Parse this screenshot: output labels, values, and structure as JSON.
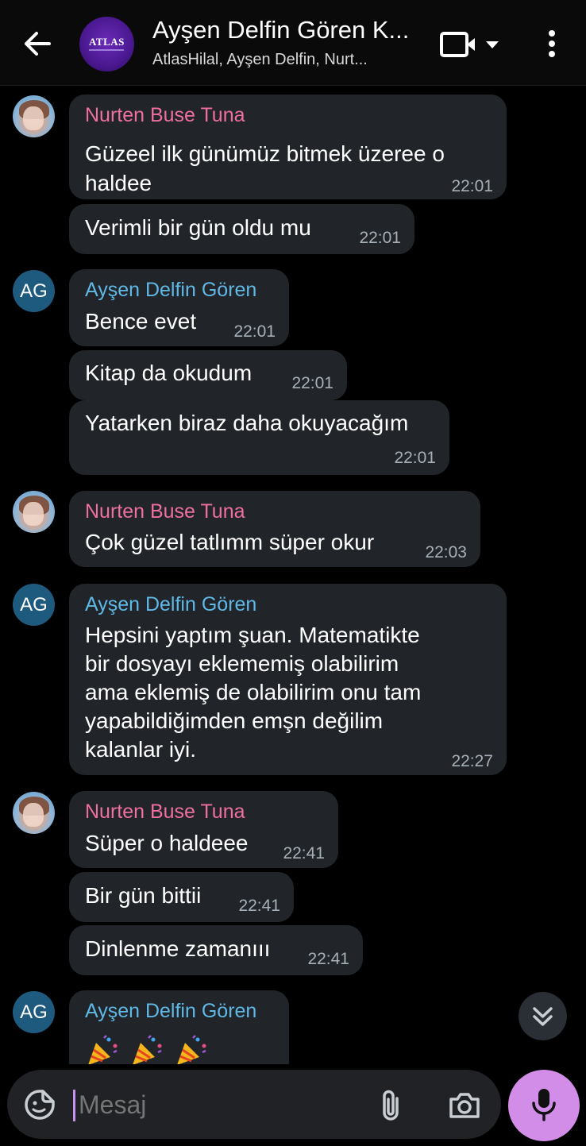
{
  "header": {
    "title": "Ayşen Delfin Gören K...",
    "subtitle": "AtlasHilal, Ayşen Delfin, Nurt...",
    "logo_text": "ATLAS"
  },
  "messages": [
    {
      "sender": "Nurten Buse Tuna",
      "lines": [
        "Güzeel ilk günümüz bitmek üzeree o",
        "haldee"
      ],
      "time": "22:01"
    },
    {
      "sender": "",
      "lines": [
        "Verimli bir gün oldu mu"
      ],
      "time": "22:01"
    },
    {
      "sender": "Ayşen Delfin Gören",
      "initials": "AG",
      "lines": [
        "Bence evet"
      ],
      "time": "22:01"
    },
    {
      "sender": "",
      "lines": [
        "Kitap da okudum"
      ],
      "time": "22:01"
    },
    {
      "sender": "",
      "lines": [
        "Yatarken biraz daha okuyacağım"
      ],
      "time": "22:01"
    },
    {
      "sender": "Nurten Buse Tuna",
      "lines": [
        "Çok güzel tatlımm süper okur"
      ],
      "time": "22:03"
    },
    {
      "sender": "Ayşen Delfin Gören",
      "initials": "AG",
      "lines": [
        "Hepsini yaptım şuan. Matematikte",
        "bir dosyayı eklememiş olabilirim",
        "ama eklemiş de olabilirim onu tam",
        "yapabildiğimden emşn değilim",
        "kalanlar iyi."
      ],
      "time": "22:27"
    },
    {
      "sender": "Nurten Buse Tuna",
      "lines": [
        "Süper o haldeee"
      ],
      "time": "22:41"
    },
    {
      "sender": "",
      "lines": [
        "Bir gün bittii"
      ],
      "time": "22:41"
    },
    {
      "sender": "",
      "lines": [
        "Dinlenme zamanııı"
      ],
      "time": "22:41"
    },
    {
      "sender": "Ayşen Delfin Gören",
      "initials": "AG",
      "emoji": [
        "party-popper",
        "party-popper",
        "party-popper"
      ]
    }
  ],
  "composer": {
    "placeholder": "Mesaj"
  },
  "colors": {
    "bubble": "#212529",
    "sender_pink": "#ef6f9f",
    "sender_blue": "#5fb8e6",
    "mic_button": "#d28de8",
    "initials_avatar": "#1e5a7e"
  },
  "icons": [
    "back-arrow-icon",
    "video-call-icon",
    "dropdown-caret-icon",
    "more-vert-icon",
    "scroll-down-icon",
    "sticker-icon",
    "paperclip-icon",
    "camera-icon",
    "microphone-icon"
  ]
}
